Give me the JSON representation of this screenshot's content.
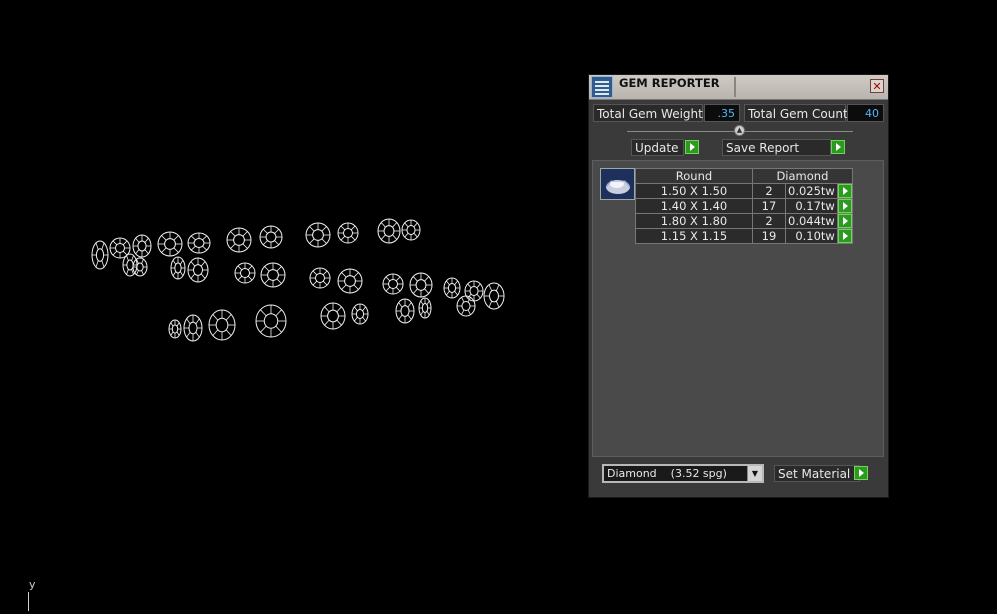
{
  "viewport": {
    "axis_label": "y"
  },
  "panel": {
    "title": "GEM REPORTER",
    "close_symbol": "✕",
    "total_weight_label": "Total Gem Weight",
    "total_weight_value": ".35",
    "total_count_label": "Total Gem Count",
    "total_count_value": "40",
    "update_label": "Update",
    "save_report_label": "Save Report",
    "table": {
      "headers": [
        "Round",
        "Diamond"
      ],
      "rows": [
        {
          "size": "1.50 X 1.50",
          "count": "2",
          "weight": "0.025tw"
        },
        {
          "size": "1.40 X 1.40",
          "count": "17",
          "weight": "0.17tw"
        },
        {
          "size": "1.80 X 1.80",
          "count": "2",
          "weight": "0.044tw"
        },
        {
          "size": "1.15 X 1.15",
          "count": "19",
          "weight": "0.10tw"
        }
      ]
    },
    "material_select_value": "Diamond    (3.52 spg)",
    "set_material_label": "Set Material"
  },
  "icons": {
    "app": "gem-reporter-app-icon",
    "close": "close-icon",
    "go": "green-arrow-icon",
    "dropdown": "chevron-down-icon",
    "thumbnail": "gem-thumbnail-icon"
  },
  "colors": {
    "go_button": "#2c9a1f",
    "value_text": "#4fb6ff",
    "background": "#000000"
  }
}
